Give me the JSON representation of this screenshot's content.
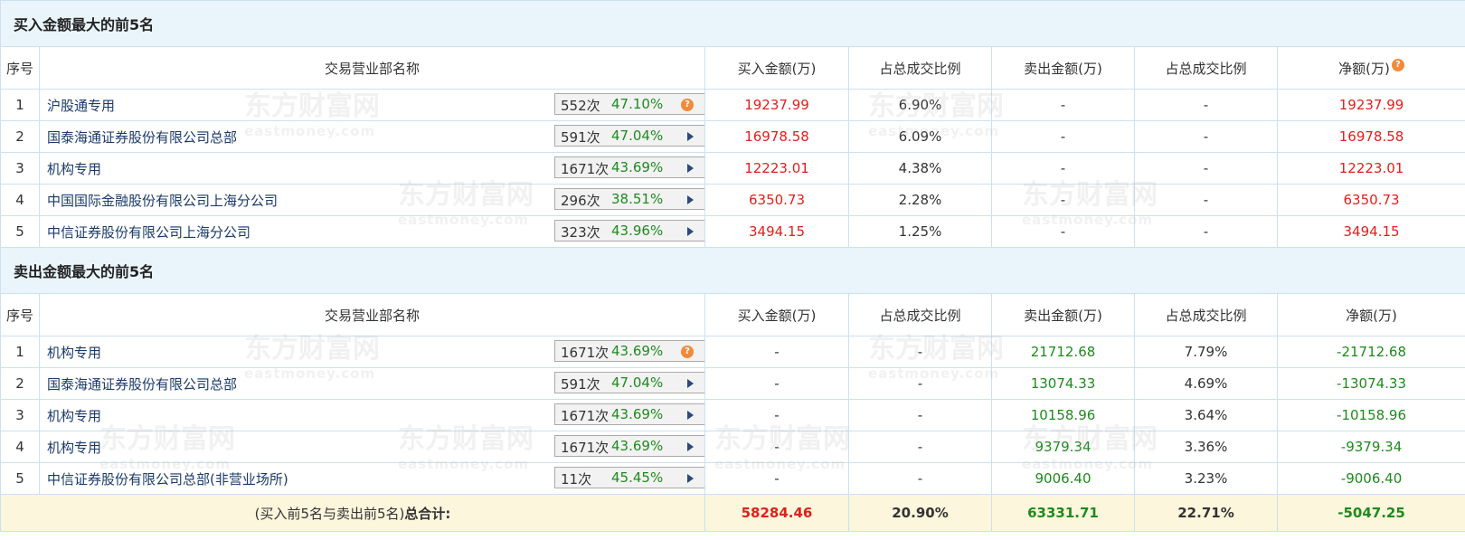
{
  "watermark": {
    "cn": "东方财富网",
    "en": "eastmoney.com"
  },
  "buy_section": {
    "title": "买入金额最大的前5名",
    "headers": {
      "seq": "序号",
      "name": "交易营业部名称",
      "buy": "买入金额(万)",
      "buy_ratio": "占总成交比例",
      "sell": "卖出金额(万)",
      "sell_ratio": "占总成交比例",
      "net": "净额(万)"
    },
    "rows": [
      {
        "seq": "1",
        "name": "沪股通专用",
        "count": "552次",
        "rate": "47.10%",
        "icon": "question-icon",
        "buy": "19237.99",
        "buy_ratio": "6.90%",
        "sell": "-",
        "sell_ratio": "-",
        "net": "19237.99"
      },
      {
        "seq": "2",
        "name": "国泰海通证券股份有限公司总部",
        "count": "591次",
        "rate": "47.04%",
        "icon": "arrow-right-icon",
        "buy": "16978.58",
        "buy_ratio": "6.09%",
        "sell": "-",
        "sell_ratio": "-",
        "net": "16978.58"
      },
      {
        "seq": "3",
        "name": "机构专用",
        "count": "1671次",
        "rate": "43.69%",
        "icon": "arrow-right-icon",
        "buy": "12223.01",
        "buy_ratio": "4.38%",
        "sell": "-",
        "sell_ratio": "-",
        "net": "12223.01"
      },
      {
        "seq": "4",
        "name": "中国国际金融股份有限公司上海分公司",
        "count": "296次",
        "rate": "38.51%",
        "icon": "arrow-right-icon",
        "buy": "6350.73",
        "buy_ratio": "2.28%",
        "sell": "-",
        "sell_ratio": "-",
        "net": "6350.73"
      },
      {
        "seq": "5",
        "name": "中信证券股份有限公司上海分公司",
        "count": "323次",
        "rate": "43.96%",
        "icon": "arrow-right-icon",
        "buy": "3494.15",
        "buy_ratio": "1.25%",
        "sell": "-",
        "sell_ratio": "-",
        "net": "3494.15"
      }
    ]
  },
  "sell_section": {
    "title": "卖出金额最大的前5名",
    "headers": {
      "seq": "序号",
      "name": "交易营业部名称",
      "buy": "买入金额(万)",
      "buy_ratio": "占总成交比例",
      "sell": "卖出金额(万)",
      "sell_ratio": "占总成交比例",
      "net": "净额(万)"
    },
    "rows": [
      {
        "seq": "1",
        "name": "机构专用",
        "count": "1671次",
        "rate": "43.69%",
        "icon": "question-icon",
        "buy": "-",
        "buy_ratio": "-",
        "sell": "21712.68",
        "sell_ratio": "7.79%",
        "net": "-21712.68"
      },
      {
        "seq": "2",
        "name": "国泰海通证券股份有限公司总部",
        "count": "591次",
        "rate": "47.04%",
        "icon": "arrow-right-icon",
        "buy": "-",
        "buy_ratio": "-",
        "sell": "13074.33",
        "sell_ratio": "4.69%",
        "net": "-13074.33"
      },
      {
        "seq": "3",
        "name": "机构专用",
        "count": "1671次",
        "rate": "43.69%",
        "icon": "arrow-right-icon",
        "buy": "-",
        "buy_ratio": "-",
        "sell": "10158.96",
        "sell_ratio": "3.64%",
        "net": "-10158.96"
      },
      {
        "seq": "4",
        "name": "机构专用",
        "count": "1671次",
        "rate": "43.69%",
        "icon": "arrow-right-icon",
        "buy": "-",
        "buy_ratio": "-",
        "sell": "9379.34",
        "sell_ratio": "3.36%",
        "net": "-9379.34"
      },
      {
        "seq": "5",
        "name": "中信证券股份有限公司总部(非营业场所)",
        "count": "11次",
        "rate": "45.45%",
        "icon": "arrow-right-icon",
        "buy": "-",
        "buy_ratio": "-",
        "sell": "9006.40",
        "sell_ratio": "3.23%",
        "net": "-9006.40"
      }
    ]
  },
  "total": {
    "label_prefix": "(买入前5名与卖出前5名)",
    "label_bold": "总合计:",
    "buy": "58284.46",
    "buy_ratio": "20.90%",
    "sell": "63331.71",
    "sell_ratio": "22.71%",
    "net": "-5047.25"
  },
  "colors": {
    "positive": "#e0201d",
    "negative": "#1f8a1f",
    "header_bg": "#eaf4fb",
    "total_bg": "#fbf6dc",
    "border": "#cde0f0"
  }
}
